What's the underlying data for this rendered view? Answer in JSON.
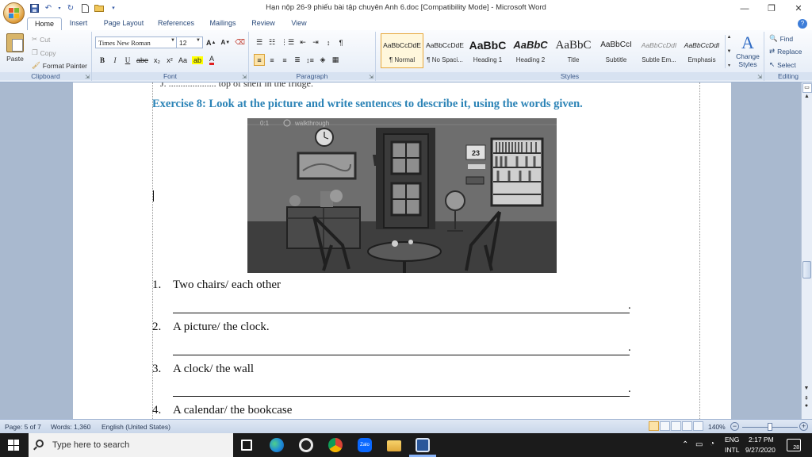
{
  "window": {
    "title": "Hạn nộp 26-9 phiếu bài tập chuyên Anh 6.doc [Compatibility Mode] - Microsoft Word",
    "controls": [
      "—",
      "❐",
      "✕"
    ]
  },
  "ribbon_tabs": [
    "Home",
    "Insert",
    "Page Layout",
    "References",
    "Mailings",
    "Review",
    "View"
  ],
  "clipboard": {
    "paste": "Paste",
    "cut": "Cut",
    "copy": "Copy",
    "format_painter": "Format Painter",
    "label": "Clipboard"
  },
  "font": {
    "name": "Times New Roman",
    "size": "12",
    "label": "Font",
    "grow": "A",
    "shrink": "A",
    "bold": "B",
    "italic": "I",
    "underline": "U",
    "strike": "abe",
    "subscript": "x₂",
    "superscript": "x²",
    "change_case": "Aa",
    "font_color": "A"
  },
  "paragraph": {
    "label": "Paragraph",
    "pilcrow": "¶"
  },
  "styles": {
    "label": "Styles",
    "items": [
      {
        "sample": "AaBbCcDdE",
        "name": "¶ Normal"
      },
      {
        "sample": "AaBbCcDdE",
        "name": "¶ No Spaci..."
      },
      {
        "sample": "AaBbC",
        "name": "Heading 1"
      },
      {
        "sample": "AaBbC",
        "name": "Heading 2"
      },
      {
        "sample": "AaBbC",
        "name": "Title"
      },
      {
        "sample": "AaBbCcI",
        "name": "Subtitle"
      },
      {
        "sample": "AaBbCcDdI",
        "name": "Subtle Em..."
      },
      {
        "sample": "AaBbCcDdI",
        "name": "Emphasis"
      }
    ],
    "change_styles": "Change Styles"
  },
  "editing": {
    "label": "Editing",
    "find": "Find",
    "replace": "Replace",
    "select": "Select"
  },
  "document": {
    "cut_line": "J. .................... top of shelf in the fridge.",
    "exercise_title": "Exercise 8: Look at the picture and write sentences to describe it, using the words given.",
    "photo": {
      "counter": "0:1",
      "caption": "walkthrough",
      "calendar_number": "23"
    },
    "questions": [
      {
        "num": "1.",
        "text": "Two chairs/ each other"
      },
      {
        "num": "2.",
        "text": "A picture/ the clock."
      },
      {
        "num": "3.",
        "text": "A clock/ the wall"
      },
      {
        "num": "4.",
        "text": "A calendar/ the bookcase"
      }
    ],
    "answer_end": "."
  },
  "statusbar": {
    "page": "Page: 5 of 7",
    "words": "Words: 1,360",
    "language": "English (United States)",
    "zoom": "140%",
    "zoom_minus": "−",
    "zoom_plus": "+"
  },
  "taskbar": {
    "search_placeholder": "Type here to search",
    "lang1": "ENG",
    "lang2": "INTL",
    "time": "2:17 PM",
    "date": "9/27/2020",
    "notifications": "28",
    "zalo": "Zalo"
  }
}
